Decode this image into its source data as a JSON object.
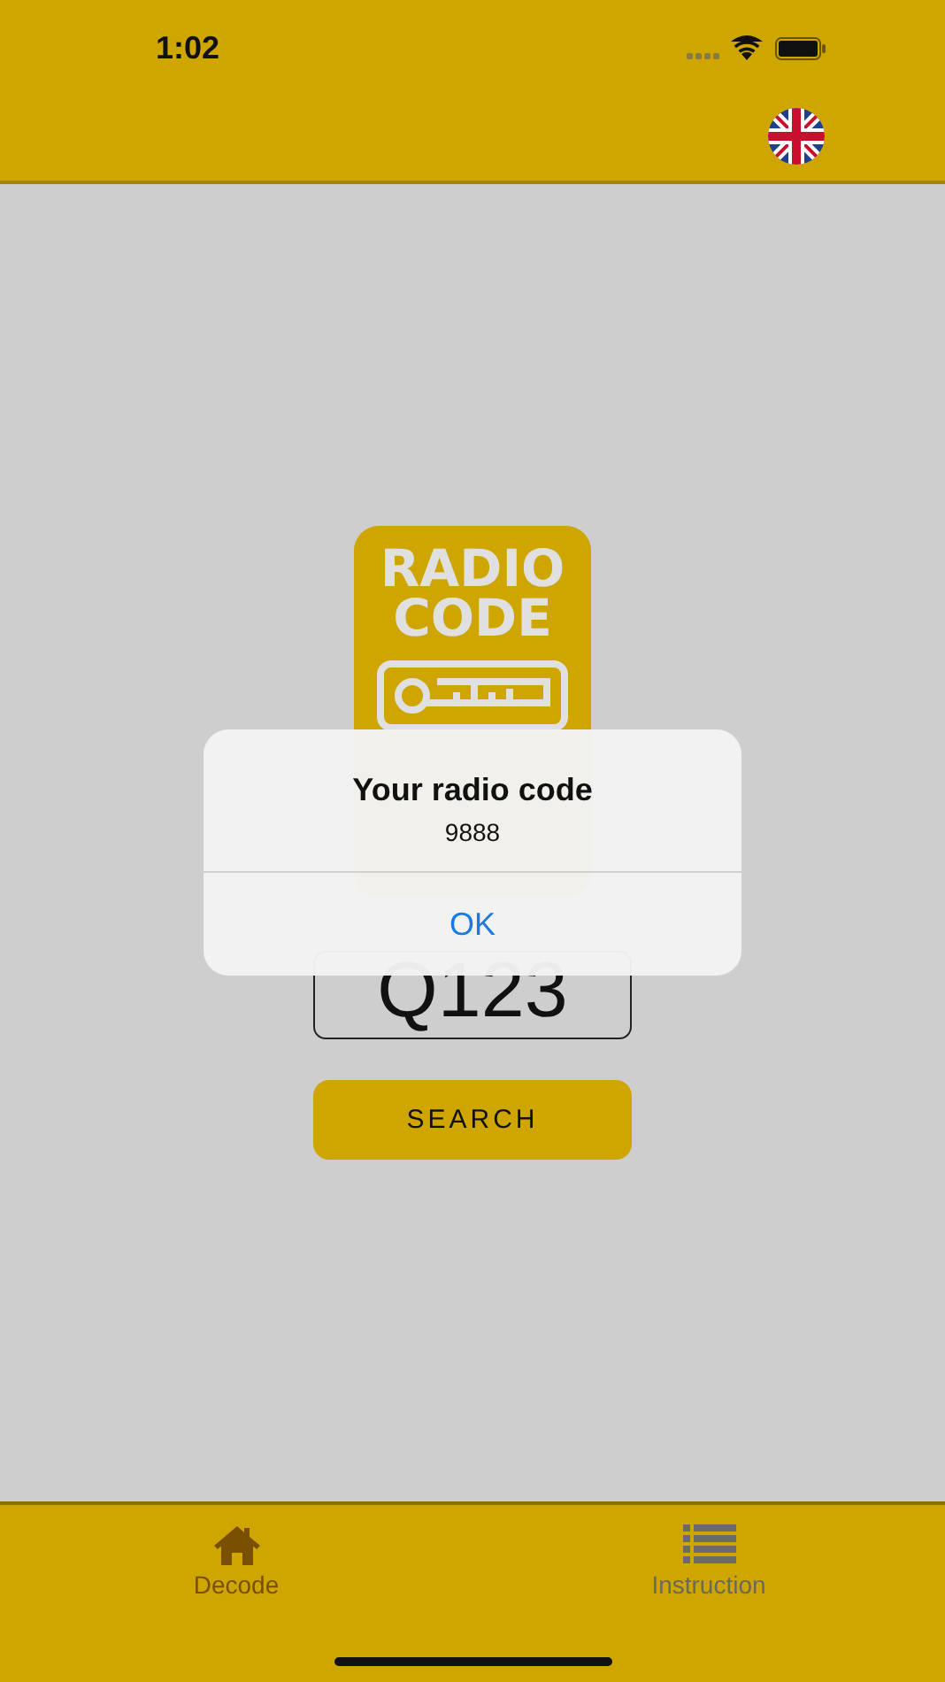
{
  "status_bar": {
    "time": "1:02"
  },
  "logo": {
    "lines": [
      "RADIO",
      "CODE"
    ]
  },
  "code_field": {
    "value": "Q123"
  },
  "search_button": {
    "label": "SEARCH"
  },
  "alert": {
    "title": "Your radio code",
    "message": "9888",
    "buttons": [
      "OK"
    ]
  },
  "tab_bar": {
    "tabs": [
      {
        "label": "Decode",
        "kind": "home",
        "selected": true
      },
      {
        "label": "Instruction",
        "kind": "list",
        "selected": false
      }
    ]
  }
}
